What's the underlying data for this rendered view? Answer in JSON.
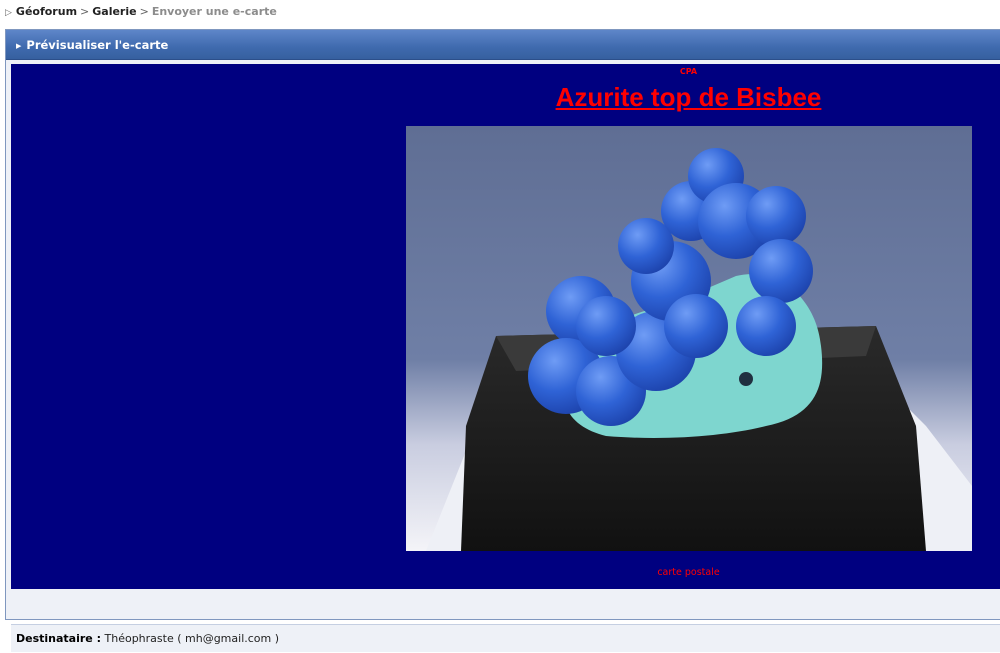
{
  "breadcrumb": {
    "items": [
      "Géoforum",
      "Galerie"
    ],
    "separator": ">",
    "current": "Envoyer une e-carte"
  },
  "panel": {
    "title": "Prévisualiser l'e-carte"
  },
  "card": {
    "top_label": "CPA",
    "title": "Azurite top de Bisbee",
    "bottom_label": "carte postale",
    "background_color": "#000080",
    "text_color": "#ff0000",
    "image_description_icon": "mineral-photo"
  },
  "recipient": {
    "label": "Destinataire :",
    "name": "Théophraste",
    "email": "( mh@gmail.com )"
  }
}
